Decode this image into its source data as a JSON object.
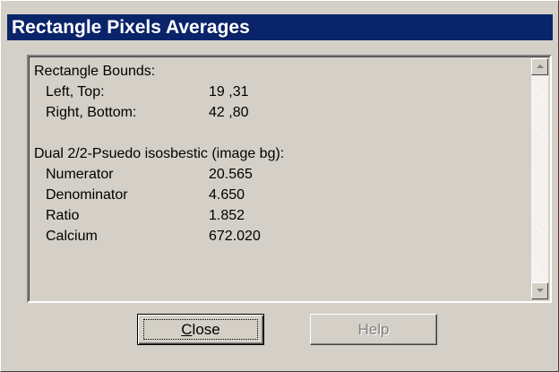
{
  "window": {
    "title": "Rectangle Pixels Averages"
  },
  "report": {
    "bounds_heading": "Rectangle Bounds:",
    "bounds": [
      {
        "label": "Left, Top:",
        "value": "19 ,31"
      },
      {
        "label": "Right, Bottom:",
        "value": "42 ,80"
      }
    ],
    "ratio_heading": "Dual 2/2-Psuedo isosbestic (image bg):",
    "measurements": [
      {
        "label": "Numerator",
        "value": "20.565"
      },
      {
        "label": "Denominator",
        "value": "4.650"
      },
      {
        "label": "Ratio",
        "value": "1.852"
      },
      {
        "label": "Calcium",
        "value": "672.020"
      }
    ]
  },
  "buttons": {
    "close_mnemonic": "C",
    "close_rest": "lose",
    "help_label": "Help",
    "help_enabled": false
  },
  "icons": {
    "scroll_up": "scroll-up-arrow-icon",
    "scroll_down": "scroll-down-arrow-icon"
  },
  "colors": {
    "titlebar": "#0a246a",
    "dialog_face": "#d4d0c8",
    "disabled_text": "#808080"
  }
}
